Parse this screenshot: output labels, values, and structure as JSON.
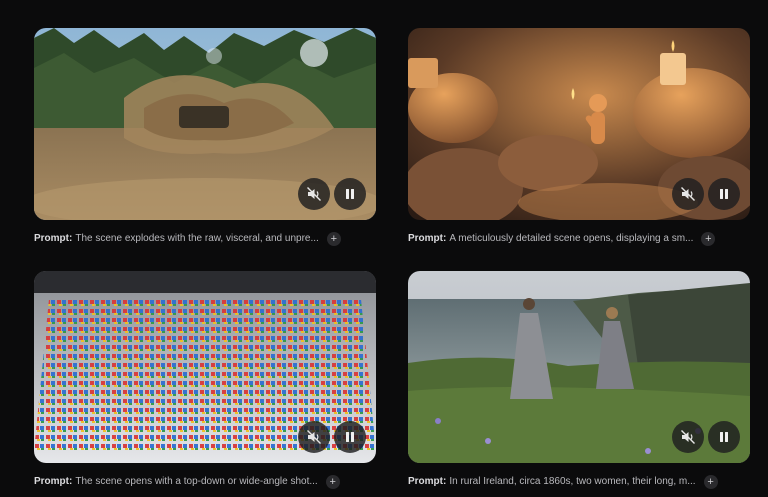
{
  "cards": [
    {
      "prompt_label": "Prompt:",
      "prompt_text": "The scene explodes with the raw, visceral, and unpre...",
      "expand_symbol": "+",
      "mute_icon": "volume-off-icon",
      "pause_icon": "pause-icon"
    },
    {
      "prompt_label": "Prompt:",
      "prompt_text": "A meticulously detailed scene opens, displaying a sm...",
      "expand_symbol": "+",
      "mute_icon": "volume-off-icon",
      "pause_icon": "pause-icon"
    },
    {
      "prompt_label": "Prompt:",
      "prompt_text": "The scene opens with a top-down or wide-angle shot...",
      "expand_symbol": "+",
      "mute_icon": "volume-off-icon",
      "pause_icon": "pause-icon"
    },
    {
      "prompt_label": "Prompt:",
      "prompt_text": "In rural Ireland, circa 1860s, two women, their long, m...",
      "expand_symbol": "+",
      "mute_icon": "volume-off-icon",
      "pause_icon": "pause-icon"
    }
  ],
  "colors": {
    "background": "#0b0b0c",
    "control_bg": "#1e1e20",
    "caption_text": "#b9b9bd"
  }
}
